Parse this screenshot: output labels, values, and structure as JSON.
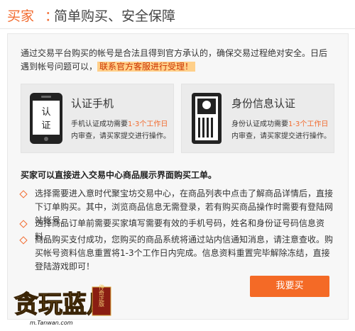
{
  "header": {
    "part1": "买家",
    "sep": "：",
    "part2": "简单购买、安全保障"
  },
  "intro": {
    "text": "通过交易平台购买的帐号是合法且得到官方承认的，确保交易过程绝对安全。日后遇到帐号问题可以，",
    "link": "联系官方客服进行受理！"
  },
  "cards": [
    {
      "icon_text": "认证",
      "icon": "phone-icon",
      "title": "认证手机",
      "line1_pre": "手机认证成功需要",
      "line1_hl": "1-3个工作日",
      "line2": "内审查，请买家提交进行操作。"
    },
    {
      "icon": "id-card-icon",
      "title": "身份信息认证",
      "line1_pre": "身份认证成功需要",
      "line1_hl": "1-3个工作日",
      "line2": "内审查，请买家提交进行操作。"
    }
  ],
  "heading": "买家可以直接进入交易中心商品展示界面购买工单。",
  "bullets": [
    "选择需要进入意时代聚宝坊交易中心，在商品列表中点击了解商品详情后，直接下订单购买。其中，浏览商品信息无需登录，若有购买商品操作时需要有登陆网站帐号。",
    "选择商品订单前需要买家填写需要有效的手机号码，姓名和身份证号码信息资料。",
    "商品购买支付成功，您购买的商品系统将通过站内信通知消息，请注意查收。购买帐号资料信息重置将1-3个工作日内完成。信息资料重置完毕解除冻结，直接登陆游戏即可！"
  ],
  "buy_button": "我要买",
  "logo": {
    "name": "贪玩蓝月",
    "sub": "m.Tanwan.com",
    "tag": "传奇正版"
  },
  "colors": {
    "accent": "#f26b2f",
    "button": "#f46a26"
  }
}
